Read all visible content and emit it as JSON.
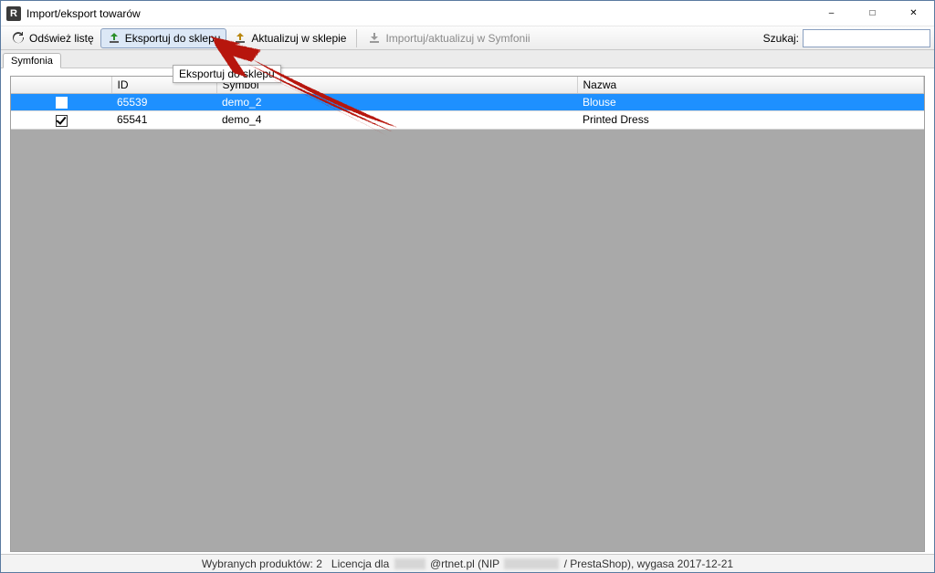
{
  "window": {
    "title": "Import/eksport towarów",
    "app_icon_letter": "R"
  },
  "toolbar": {
    "refresh": "Odśwież listę",
    "export": "Eksportuj do sklepu",
    "update_shop": "Aktualizuj w sklepie",
    "import_symfonia": "Importuj/aktualizuj w Symfonii",
    "search_label": "Szukaj:",
    "search_value": ""
  },
  "tooltip_text": "Eksportuj do sklepu",
  "tabs": {
    "active": "Symfonia"
  },
  "grid": {
    "headers": {
      "checkbox": "",
      "id": "ID",
      "symbol": "Symbol",
      "nazwa": "Nazwa"
    },
    "rows": [
      {
        "checked": true,
        "selected": true,
        "id": "65539",
        "symbol": "demo_2",
        "nazwa": "Blouse"
      },
      {
        "checked": true,
        "selected": false,
        "id": "65541",
        "symbol": "demo_4",
        "nazwa": "Printed Dress"
      }
    ]
  },
  "statusbar": {
    "segments": [
      "Wybranych produktów: 2",
      "Licencja dla",
      "@rtnet.pl (NIP",
      "/ PrestaShop), wygasa 2017-12-21"
    ]
  },
  "colors": {
    "selection": "#1e90ff",
    "annotation": "#b7140b"
  }
}
